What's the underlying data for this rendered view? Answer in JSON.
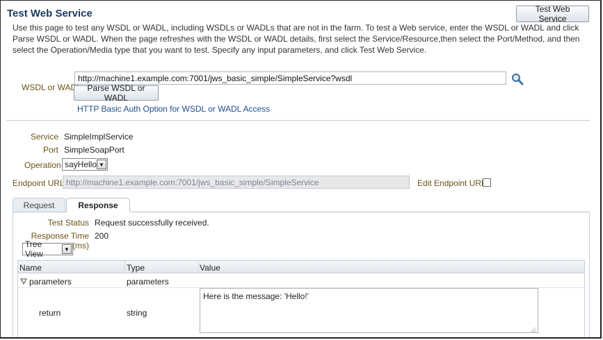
{
  "page": {
    "title": "Test Web Service",
    "test_button_label": "Test Web Service",
    "description": "Use this page to test any WSDL or WADL, including WSDLs or WADLs that are not in the farm. To test a Web service, enter the WSDL or WADL and click Parse WSDL or WADL. When the page refreshes with the WSDL or WADL details, first select the Service/Resource,then select the Port/Method, and then select the Operation/Media type that you want to test. Specify any input parameters, and click Test Web Service."
  },
  "wsdl": {
    "label": "WSDL or WADL",
    "value": "http://machine1.example.com:7001/jws_basic_simple/SimpleService?wsdl",
    "parse_button_label": "Parse WSDL or WADL",
    "auth_link": "HTTP Basic Auth Option for WSDL or WADL Access",
    "search_icon": "magnifier-icon"
  },
  "service": {
    "service_label": "Service",
    "service_value": "SimpleImplService",
    "port_label": "Port",
    "port_value": "SimpleSoapPort",
    "operation_label": "Operation",
    "operation_value": "sayHello",
    "endpoint_label": "Endpoint URL",
    "endpoint_value": "http://machine1.example.com:7001/jws_basic_simple/SimpleService",
    "edit_endpoint_label": "Edit Endpoint URL",
    "edit_endpoint_checked": false
  },
  "tabs": [
    {
      "label": "Request",
      "active": false
    },
    {
      "label": "Response",
      "active": true
    }
  ],
  "response": {
    "status_label": "Test Status",
    "status_value": "Request successfully received.",
    "time_label": "Response Time (ms)",
    "time_value": "200",
    "view_value": "Tree View",
    "table": {
      "headers": [
        "Name",
        "Type",
        "Value"
      ],
      "rows": [
        {
          "name": "parameters",
          "type": "parameters",
          "value": "",
          "expand_icon": "triangle-down-icon"
        },
        {
          "name": "return",
          "type": "string",
          "value": "Here is the message: 'Hello!'"
        }
      ]
    }
  },
  "colors": {
    "title": "#1b3a62",
    "label": "#6b5316",
    "link": "#1f4d8d"
  }
}
